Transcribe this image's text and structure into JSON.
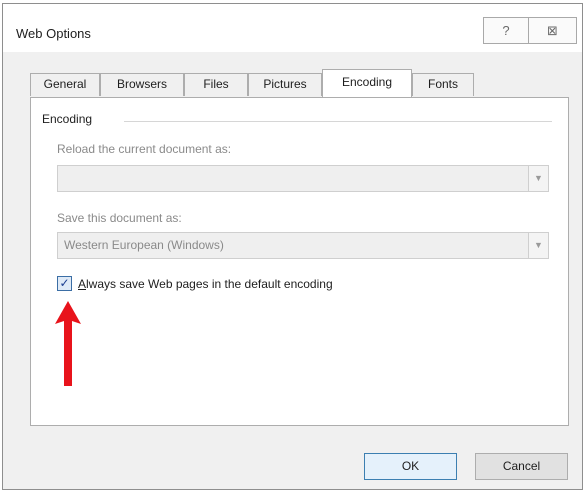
{
  "window": {
    "title": "Web Options",
    "help_glyph": "?",
    "close_glyph": "⊠"
  },
  "tabs": [
    {
      "label": "General",
      "active": false
    },
    {
      "label": "Browsers",
      "active": false
    },
    {
      "label": "Files",
      "active": false
    },
    {
      "label": "Pictures",
      "active": false
    },
    {
      "label": "Encoding",
      "active": true
    },
    {
      "label": "Fonts",
      "active": false
    }
  ],
  "encoding": {
    "group_label": "Encoding",
    "reload_label": "Reload the current document as:",
    "reload_value": "",
    "save_label": "Save this document as:",
    "save_value": "Western European (Windows)",
    "dropdown_glyph": "▼",
    "always_save_checked": true,
    "always_save_mnemonic": "A",
    "always_save_rest": "lways save Web pages in the default encoding"
  },
  "annotation": {
    "arrow_color": "#e8131b"
  },
  "buttons": {
    "ok": "OK",
    "cancel": "Cancel"
  }
}
